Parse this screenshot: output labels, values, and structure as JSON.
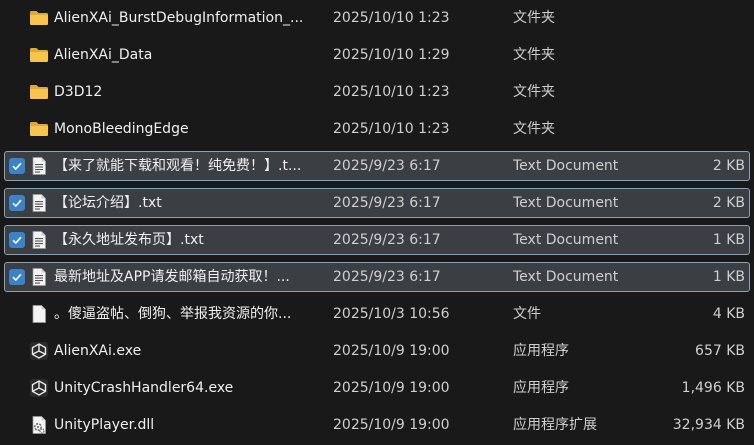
{
  "rows": [
    {
      "name": "AlienXAi_BurstDebugInformation_...",
      "date": "2025/10/10 1:23",
      "type": "文件夹",
      "size": "",
      "icon": "folder-icon",
      "selected": false
    },
    {
      "name": "AlienXAi_Data",
      "date": "2025/10/10 1:29",
      "type": "文件夹",
      "size": "",
      "icon": "folder-icon",
      "selected": false
    },
    {
      "name": "D3D12",
      "date": "2025/10/10 1:23",
      "type": "文件夹",
      "size": "",
      "icon": "folder-icon",
      "selected": false
    },
    {
      "name": "MonoBleedingEdge",
      "date": "2025/10/10 1:23",
      "type": "文件夹",
      "size": "",
      "icon": "folder-icon",
      "selected": false
    },
    {
      "name": "【来了就能下载和观看！纯免费！】.t...",
      "date": "2025/9/23 6:17",
      "type": "Text Document",
      "size": "2 KB",
      "icon": "text-document-icon",
      "selected": true
    },
    {
      "name": "【论坛介绍】.txt",
      "date": "2025/9/23 6:17",
      "type": "Text Document",
      "size": "2 KB",
      "icon": "text-document-icon",
      "selected": true
    },
    {
      "name": "【永久地址发布页】.txt",
      "date": "2025/9/23 6:17",
      "type": "Text Document",
      "size": "1 KB",
      "icon": "text-document-icon",
      "selected": true
    },
    {
      "name": "最新地址及APP请发邮箱自动获取！...",
      "date": "2025/9/23 6:17",
      "type": "Text Document",
      "size": "1 KB",
      "icon": "text-document-icon",
      "selected": true
    },
    {
      "name": "。傻逼盗帖、倒狗、举报我资源的你...",
      "date": "2025/10/3 10:56",
      "type": "文件",
      "size": "4 KB",
      "icon": "blank-file-icon",
      "selected": false
    },
    {
      "name": "AlienXAi.exe",
      "date": "2025/10/9 19:00",
      "type": "应用程序",
      "size": "657 KB",
      "icon": "unity-app-icon",
      "selected": false
    },
    {
      "name": "UnityCrashHandler64.exe",
      "date": "2025/10/9 19:00",
      "type": "应用程序",
      "size": "1,496 KB",
      "icon": "unity-app-icon",
      "selected": false
    },
    {
      "name": "UnityPlayer.dll",
      "date": "2025/10/9 19:00",
      "type": "应用程序扩展",
      "size": "32,934 KB",
      "icon": "dll-file-icon",
      "selected": false
    }
  ]
}
